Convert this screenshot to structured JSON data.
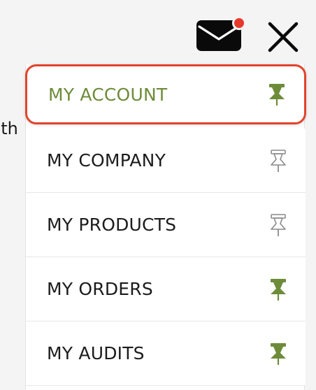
{
  "background": {
    "partial_text": "uth"
  },
  "header": {
    "mail_icon": "envelope-icon",
    "close_icon": "close-icon",
    "notification_color": "#e8382c"
  },
  "menu": {
    "items": [
      {
        "label": "MY ACCOUNT",
        "pinned": true,
        "active": true
      },
      {
        "label": "MY COMPANY",
        "pinned": false,
        "active": false
      },
      {
        "label": "MY PRODUCTS",
        "pinned": false,
        "active": false
      },
      {
        "label": "MY ORDERS",
        "pinned": true,
        "active": false
      },
      {
        "label": "MY AUDITS",
        "pinned": true,
        "active": false
      }
    ]
  },
  "colors": {
    "accent_green": "#6d8c3a",
    "highlight_border": "#e2442b",
    "pin_unpinned": "#8a8a8a"
  }
}
